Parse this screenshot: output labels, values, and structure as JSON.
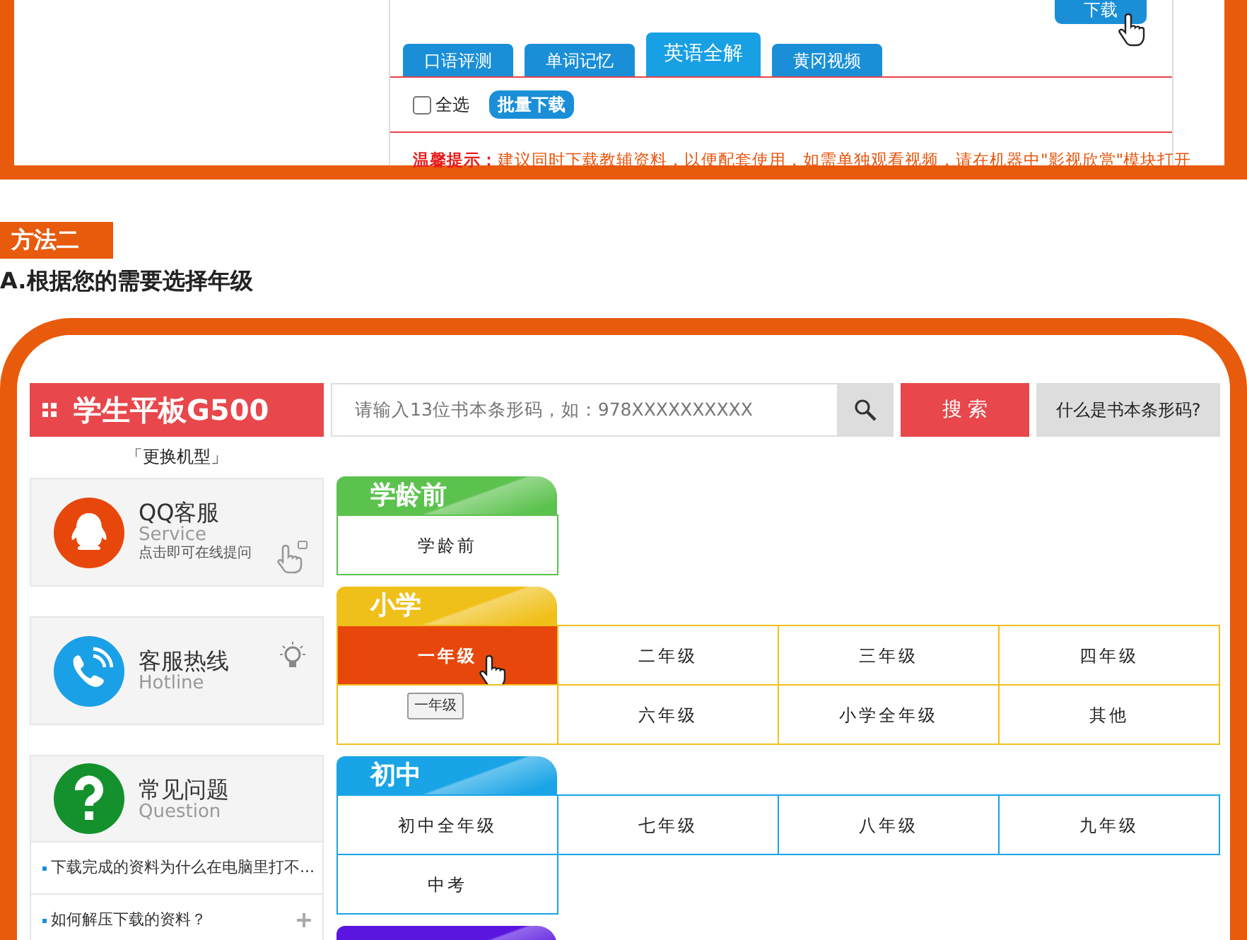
{
  "top_panel": {
    "download_button": "下载",
    "tabs": [
      {
        "label": "口语评测",
        "selected": false
      },
      {
        "label": "单词记忆",
        "selected": false
      },
      {
        "label": "英语全解",
        "selected": true
      },
      {
        "label": "黄冈视频",
        "selected": false
      }
    ],
    "select_all": {
      "label": "全选",
      "checked": false
    },
    "batch_button": "批量下载",
    "tip_label": "温馨提示：",
    "tip_text": "建议同时下载教辅资料，以便配套使用，如需单独观看视频，请在机器中\"影视欣赏\"模块打开"
  },
  "method_label": "方法二",
  "instruction": "A.根据您的需要选择年级",
  "header": {
    "logo": "学生平板G500",
    "search": {
      "placeholder": "请输入13位书本条形码，如：978XXXXXXXXXX"
    },
    "search_button": "搜 索",
    "help_button": "什么是书本条形码?",
    "change_model": "「更换机型」"
  },
  "sidebar": {
    "cards": [
      {
        "kind": "qq",
        "title": "QQ客服",
        "subtitle": "Service",
        "note": "点击即可在线提问"
      },
      {
        "kind": "phone",
        "title": "客服热线",
        "subtitle": "Hotline"
      },
      {
        "kind": "question",
        "title": "常见问题",
        "subtitle": "Question"
      }
    ],
    "faq": [
      {
        "text": "下载完成的资料为什么在电脑里打不..."
      },
      {
        "text": "如何解压下载的资料？"
      }
    ]
  },
  "stages": [
    {
      "name": "学龄前",
      "color": "#5cc24e",
      "grades": [
        {
          "label": "学龄前",
          "selected": false
        }
      ]
    },
    {
      "name": "小学",
      "color": "#f0c01a",
      "grades": [
        {
          "label": "一年级",
          "selected": true
        },
        {
          "label": "二年级",
          "selected": false
        },
        {
          "label": "三年级",
          "selected": false
        },
        {
          "label": "四年级",
          "selected": false
        },
        {
          "tooltip": "一年级",
          "selected": false
        },
        {
          "label": "六年级",
          "selected": false
        },
        {
          "label": "小学全年级",
          "selected": false
        },
        {
          "label": "其他",
          "selected": false
        }
      ]
    },
    {
      "name": "初中",
      "color": "#18a4e6",
      "grades": [
        {
          "label": "初中全年级",
          "selected": false
        },
        {
          "label": "七年级",
          "selected": false
        },
        {
          "label": "八年级",
          "selected": false
        },
        {
          "label": "九年级",
          "selected": false
        },
        {
          "label": "中考",
          "selected": false
        }
      ]
    },
    {
      "color": "#5a16e0"
    }
  ]
}
